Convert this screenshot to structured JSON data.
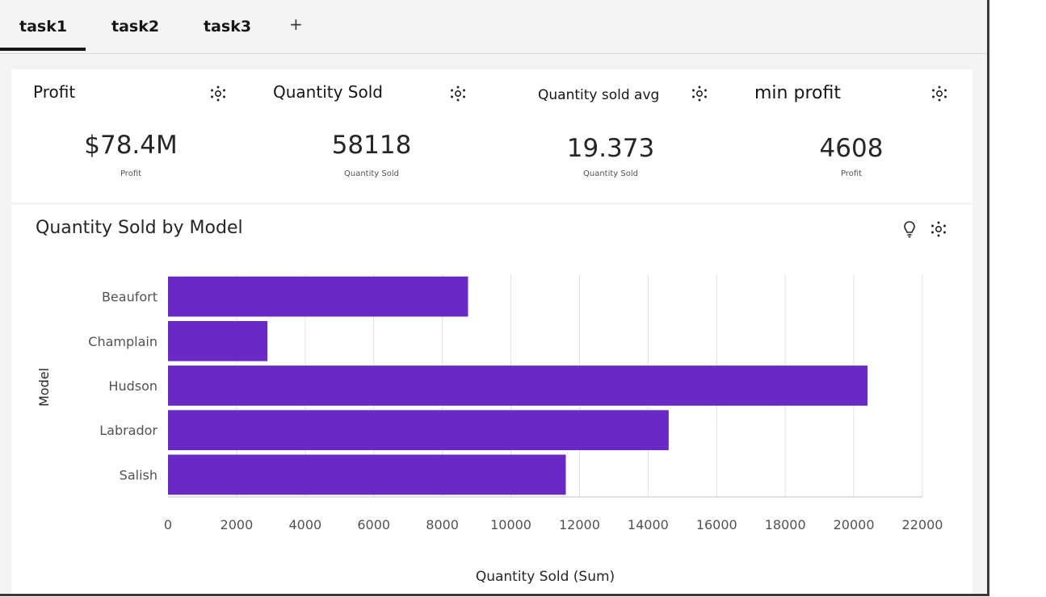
{
  "tabs": [
    {
      "label": "task1",
      "active": true
    },
    {
      "label": "task2",
      "active": false
    },
    {
      "label": "task3",
      "active": false
    }
  ],
  "add_tab_label": "+",
  "kpis": [
    {
      "title": "Profit",
      "value": "$78.4M",
      "subtitle": "Profit",
      "icon": "gear-icon"
    },
    {
      "title": "Quantity Sold",
      "value": "58118",
      "subtitle": "Quantity Sold",
      "icon": "gear-icon"
    },
    {
      "title": "Quantity sold avg",
      "value": "19.373",
      "subtitle": "Quantity Sold",
      "icon": "gear-icon"
    },
    {
      "title": "min profit",
      "value": "4608",
      "subtitle": "Profit",
      "icon": "gear-icon"
    }
  ],
  "chart_panel": {
    "title": "Quantity Sold by Model",
    "icons": [
      "lightbulb-icon",
      "gear-icon"
    ]
  },
  "chart_data": {
    "type": "bar",
    "orientation": "horizontal",
    "title": "Quantity Sold by Model",
    "categories": [
      "Beaufort",
      "Champlain",
      "Hudson",
      "Labrador",
      "Salish"
    ],
    "values": [
      8750,
      2900,
      20400,
      14600,
      11600
    ],
    "xlabel": "Quantity Sold (Sum)",
    "ylabel": "Model",
    "xlim": [
      0,
      22000
    ],
    "xticks": [
      "0",
      "2000",
      "4000",
      "6000",
      "8000",
      "10000",
      "12000",
      "14000",
      "16000",
      "18000",
      "20000",
      "22000"
    ],
    "grid": "vertical",
    "bar_color": "#6929c4"
  },
  "colors": {
    "accent": "#6929c4",
    "background": "#f4f4f4",
    "panel": "#ffffff",
    "text": "#161616"
  }
}
